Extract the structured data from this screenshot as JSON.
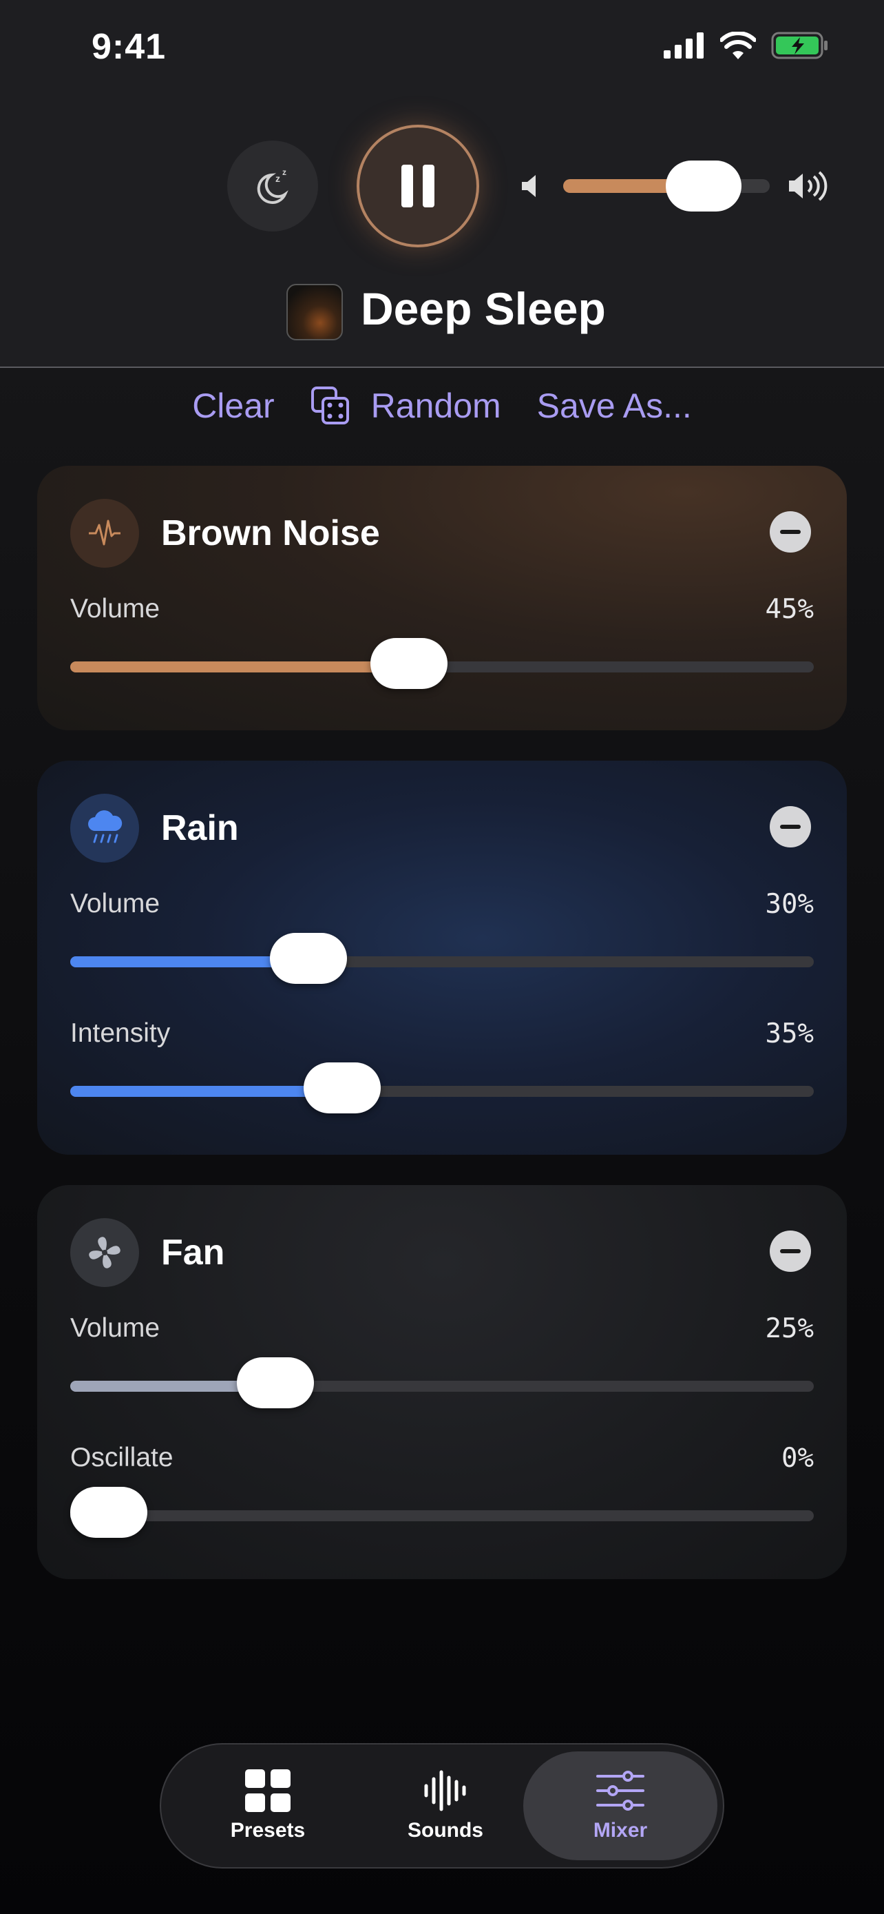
{
  "status_bar": {
    "time": "9:41"
  },
  "player": {
    "preset_name": "Deep Sleep",
    "master_volume": 0.68,
    "accent": "#c88a5c"
  },
  "actions": {
    "clear": "Clear",
    "random": "Random",
    "save_as": "Save As..."
  },
  "channels": [
    {
      "name": "Brown Noise",
      "icon": "waveform-icon",
      "color": "#c88a5c",
      "controls": [
        {
          "label": "Volume",
          "value_text": "45%",
          "value": 0.45
        }
      ]
    },
    {
      "name": "Rain",
      "icon": "cloud-rain-icon",
      "color": "#4d86f0",
      "controls": [
        {
          "label": "Volume",
          "value_text": "30%",
          "value": 0.3
        },
        {
          "label": "Intensity",
          "value_text": "35%",
          "value": 0.35
        }
      ]
    },
    {
      "name": "Fan",
      "icon": "fan-icon",
      "color": "#9ea5b8",
      "controls": [
        {
          "label": "Volume",
          "value_text": "25%",
          "value": 0.25
        },
        {
          "label": "Oscillate",
          "value_text": "0%",
          "value": 0.0
        }
      ]
    }
  ],
  "tabs": [
    {
      "label": "Presets",
      "icon": "grid-icon"
    },
    {
      "label": "Sounds",
      "icon": "waveform-icon"
    },
    {
      "label": "Mixer",
      "icon": "sliders-icon",
      "active": true
    }
  ]
}
